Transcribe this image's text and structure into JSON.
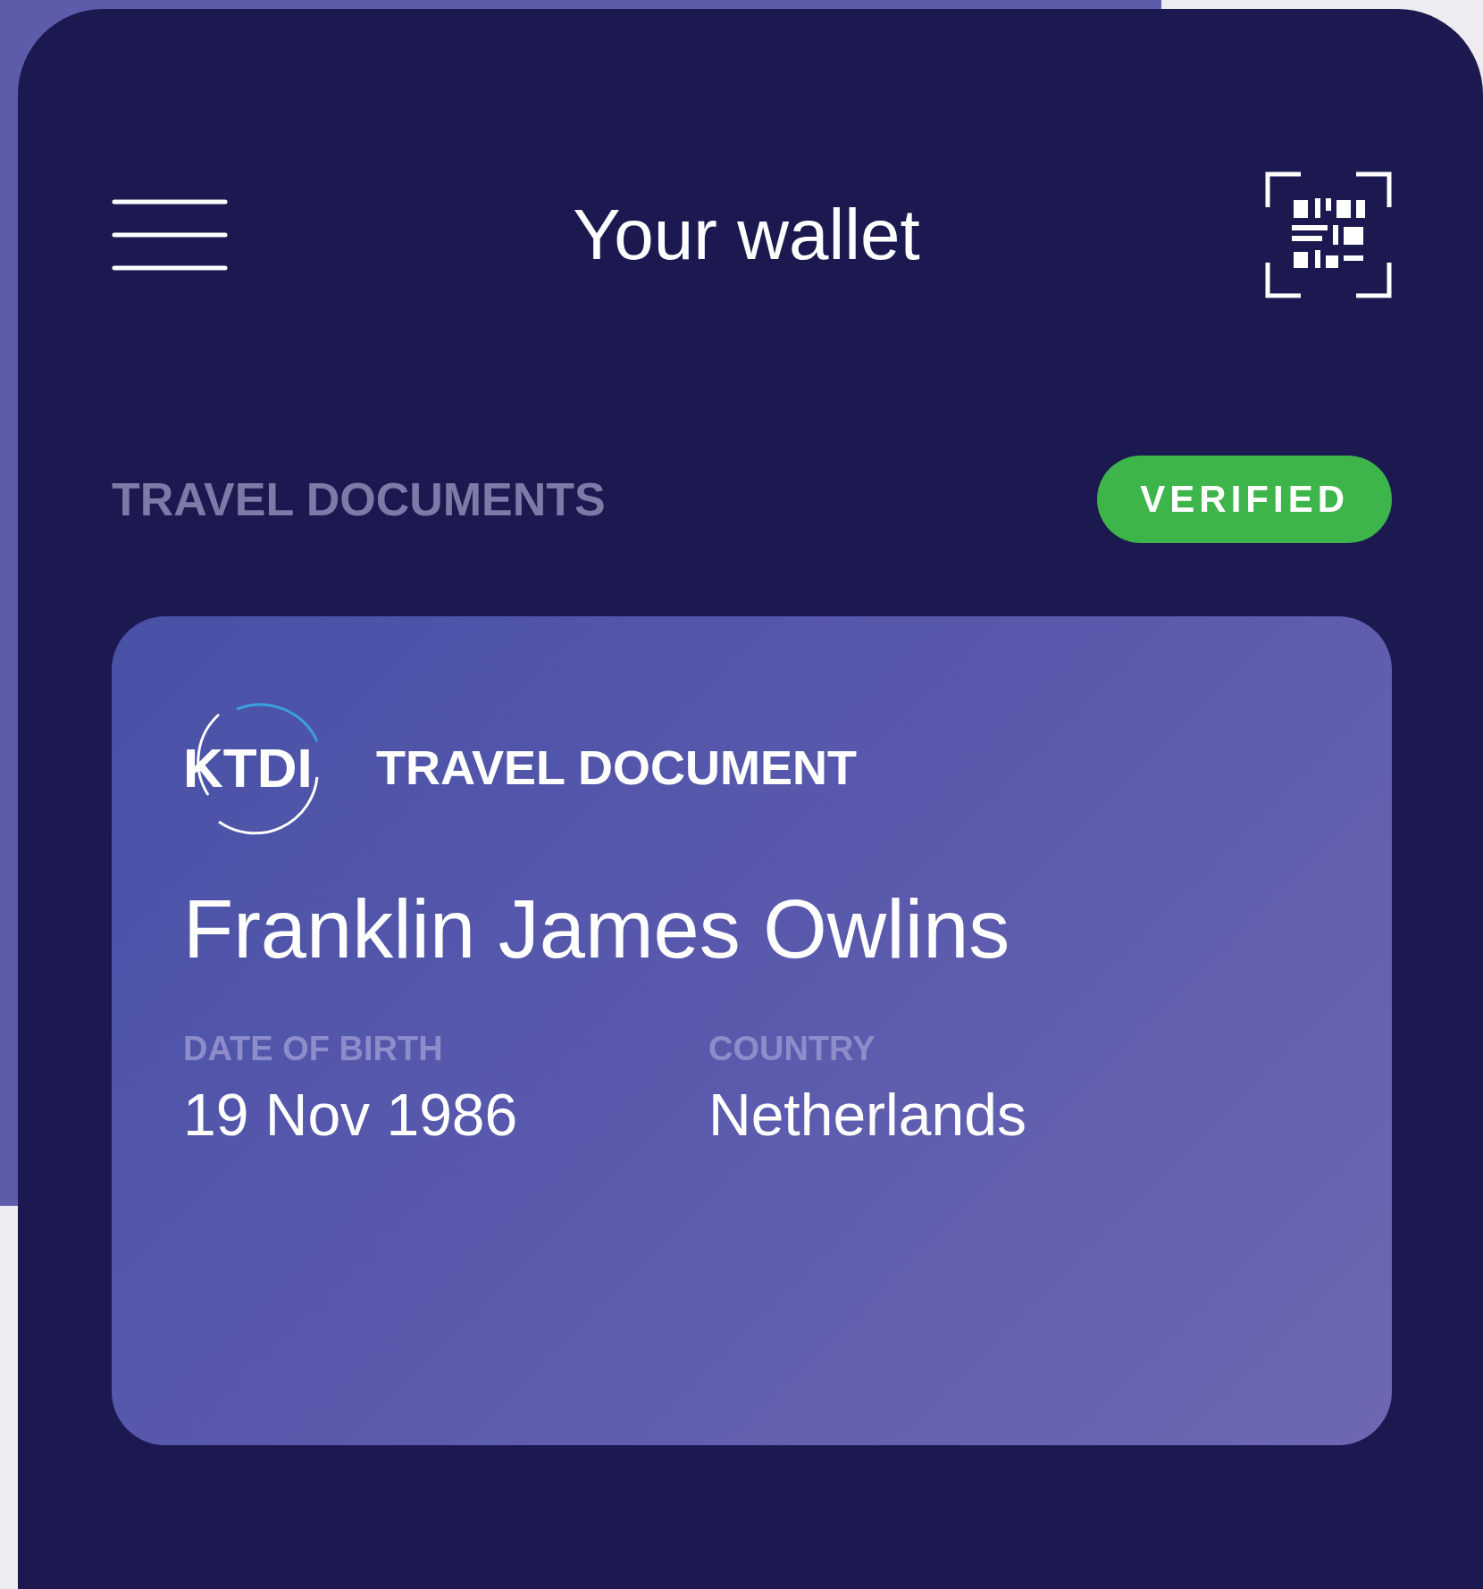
{
  "header": {
    "title": "Your wallet"
  },
  "section": {
    "title": "TRAVEL DOCUMENTS",
    "status": "VERIFIED"
  },
  "card": {
    "logo": "KTDI",
    "type": "TRAVEL DOCUMENT",
    "name": "Franklin James Owlins",
    "fields": [
      {
        "label": "DATE OF BIRTH",
        "value": "19 Nov 1986"
      },
      {
        "label": "COUNTRY",
        "value": "Netherlands"
      }
    ]
  }
}
